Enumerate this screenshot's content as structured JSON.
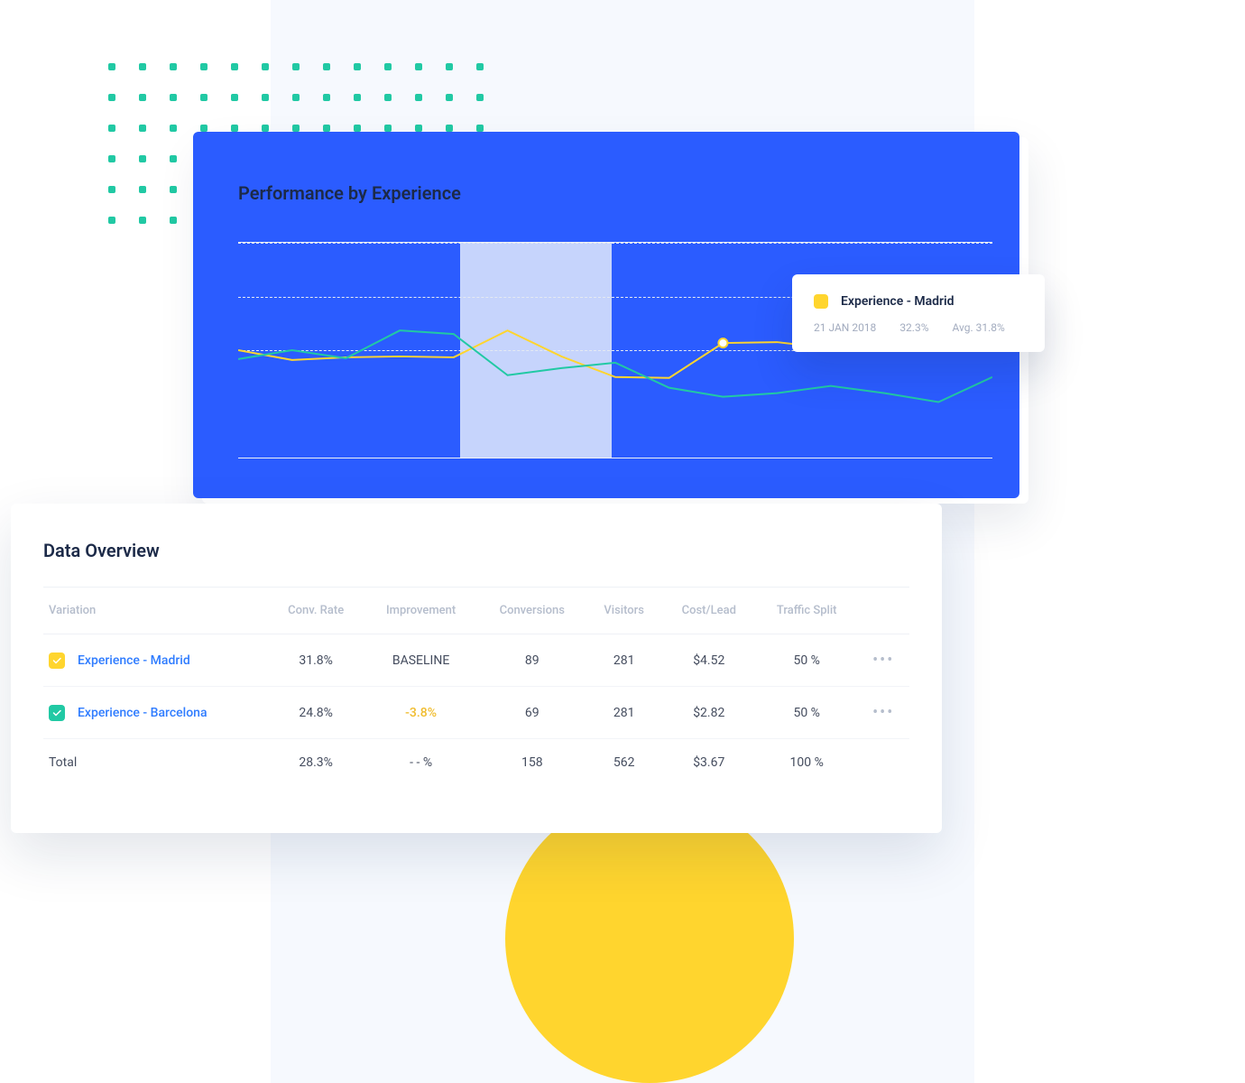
{
  "performance": {
    "title": "Performance by Experience"
  },
  "tooltip": {
    "title": "Experience - Madrid",
    "date": "21 JAN 2018",
    "value": "32.3%",
    "avg": "Avg. 31.8%"
  },
  "table": {
    "title": "Data Overview",
    "headers": {
      "variation": "Variation",
      "conv_rate": "Conv. Rate",
      "improvement": "Improvement",
      "conversions": "Conversions",
      "visitors": "Visitors",
      "cost_lead": "Cost/Lead",
      "traffic_split": "Traffic Split"
    },
    "rows": [
      {
        "name": "Experience - Madrid",
        "color": "yellow",
        "conv_rate": "31.8%",
        "improvement": "BASELINE",
        "improvement_class": "",
        "conversions": "89",
        "visitors": "281",
        "cost_lead": "$4.52",
        "traffic_split": "50 %"
      },
      {
        "name": "Experience - Barcelona",
        "color": "teal",
        "conv_rate": "24.8%",
        "improvement": "-3.8%",
        "improvement_class": "neg",
        "conversions": "69",
        "visitors": "281",
        "cost_lead": "$2.82",
        "traffic_split": "50 %"
      }
    ],
    "total": {
      "name": "Total",
      "conv_rate": "28.3%",
      "improvement": "- - %",
      "conversions": "158",
      "visitors": "562",
      "cost_lead": "$3.67",
      "traffic_split": "100 %"
    }
  },
  "chart_data": {
    "type": "line",
    "title": "Performance by Experience",
    "x": [
      0,
      1,
      2,
      3,
      4,
      5,
      6,
      7,
      8,
      9,
      10,
      11,
      12,
      13
    ],
    "highlight_range": [
      4,
      7
    ],
    "marker_index": 9,
    "series": [
      {
        "name": "Experience - Madrid",
        "color": "#ffd52e",
        "values": [
          120,
          131,
          128,
          127,
          128,
          98,
          127,
          150,
          151,
          112,
          111,
          118,
          116,
          117,
          116
        ]
      },
      {
        "name": "Experience - Barcelona",
        "color": "#21c9a4",
        "values": [
          130,
          120,
          129,
          98,
          102,
          148,
          140,
          134,
          162,
          172,
          168,
          160,
          168,
          178,
          150
        ]
      }
    ],
    "ylabel": "",
    "xlabel": ""
  },
  "colors": {
    "yellow": "#ffd52e",
    "teal": "#21c9a4",
    "blue": "#2b5cff"
  }
}
